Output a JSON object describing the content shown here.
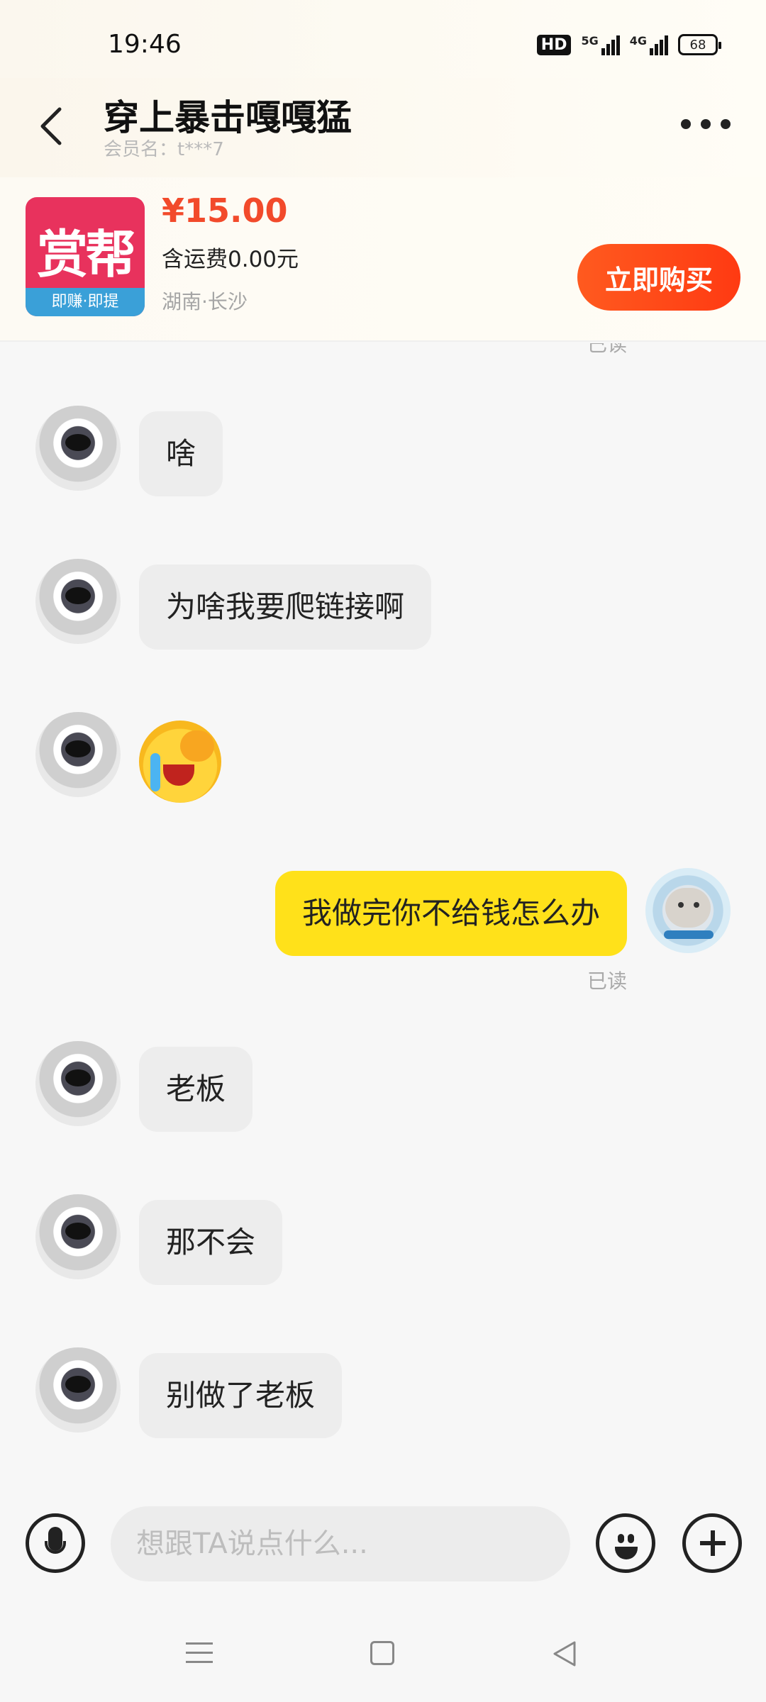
{
  "status_bar": {
    "time": "19:46",
    "hd": "HD",
    "sim1": "5G",
    "sim2": "4G",
    "battery": "68"
  },
  "header": {
    "title": "穿上暴击嘎嘎猛",
    "subtitle": "会员名：t***7",
    "back_icon": "chevron-left-icon",
    "more_icon": "more-dots-icon"
  },
  "product": {
    "thumb_main": "赏帮",
    "thumb_sub": "即赚·即提",
    "price": "¥15.00",
    "shipping": "含运费0.00元",
    "location": "湖南·长沙",
    "buy_label": "立即购买"
  },
  "chat": {
    "read_top": "已读",
    "messages": [
      {
        "side": "left",
        "type": "text",
        "text": "啥"
      },
      {
        "side": "left",
        "type": "text",
        "text": "为啥我要爬链接啊"
      },
      {
        "side": "left",
        "type": "emoji",
        "emoji": "crying-face-emoji"
      },
      {
        "side": "right",
        "type": "text",
        "text": "我做完你不给钱怎么办",
        "status": "已读"
      },
      {
        "side": "left",
        "type": "text",
        "text": "老板"
      },
      {
        "side": "left",
        "type": "text",
        "text": "那不会"
      },
      {
        "side": "left",
        "type": "text",
        "text": "别做了老板"
      }
    ]
  },
  "input_bar": {
    "placeholder": "想跟TA说点什么...",
    "voice_icon": "microphone-icon",
    "emoji_icon": "smiley-icon",
    "plus_icon": "plus-icon"
  },
  "nav_bar": {
    "menu_icon": "menu-icon",
    "home_icon": "home-square-icon",
    "back_icon": "back-triangle-icon"
  },
  "colors": {
    "accent": "#ff4a1c",
    "price": "#f24a2b",
    "my_bubble": "#ffe11a",
    "their_bubble": "#ededed"
  }
}
